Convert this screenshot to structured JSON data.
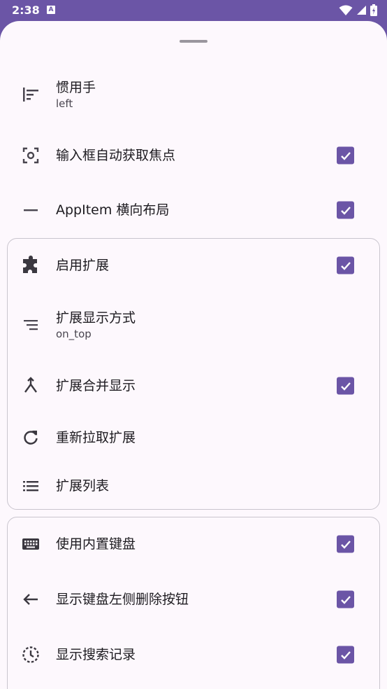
{
  "status_bar": {
    "time": "2:38",
    "notification_badge": "A"
  },
  "settings": {
    "handedness": {
      "label": "惯用手",
      "value": "left",
      "icon": "align-left-icon"
    },
    "autofocus": {
      "label": "输入框自动获取焦点",
      "checked": true,
      "icon": "focus-center-icon"
    },
    "appitem_horizontal": {
      "label": "AppItem 横向布局",
      "checked": true,
      "icon": "horizontal-rule-icon"
    }
  },
  "extensions_group": {
    "enable": {
      "label": "启用扩展",
      "checked": true,
      "icon": "puzzle-icon"
    },
    "display_mode": {
      "label": "扩展显示方式",
      "value": "on_top",
      "icon": "sort-lines-icon"
    },
    "merge_display": {
      "label": "扩展合并显示",
      "checked": true,
      "icon": "merge-icon"
    },
    "refetch": {
      "label": "重新拉取扩展",
      "icon": "refresh-icon"
    },
    "list": {
      "label": "扩展列表",
      "icon": "list-icon"
    }
  },
  "keyboard_group": {
    "builtin_keyboard": {
      "label": "使用内置键盘",
      "checked": true,
      "icon": "keyboard-icon"
    },
    "delete_button_left": {
      "label": "显示键盘左侧删除按钮",
      "checked": true,
      "icon": "arrow-left-icon"
    },
    "search_history": {
      "label": "显示搜索记录",
      "checked": true,
      "icon": "history-icon"
    }
  },
  "colors": {
    "accent": "#6b55a6",
    "surface": "#fdf8fd",
    "outline": "#c9c5ce"
  }
}
